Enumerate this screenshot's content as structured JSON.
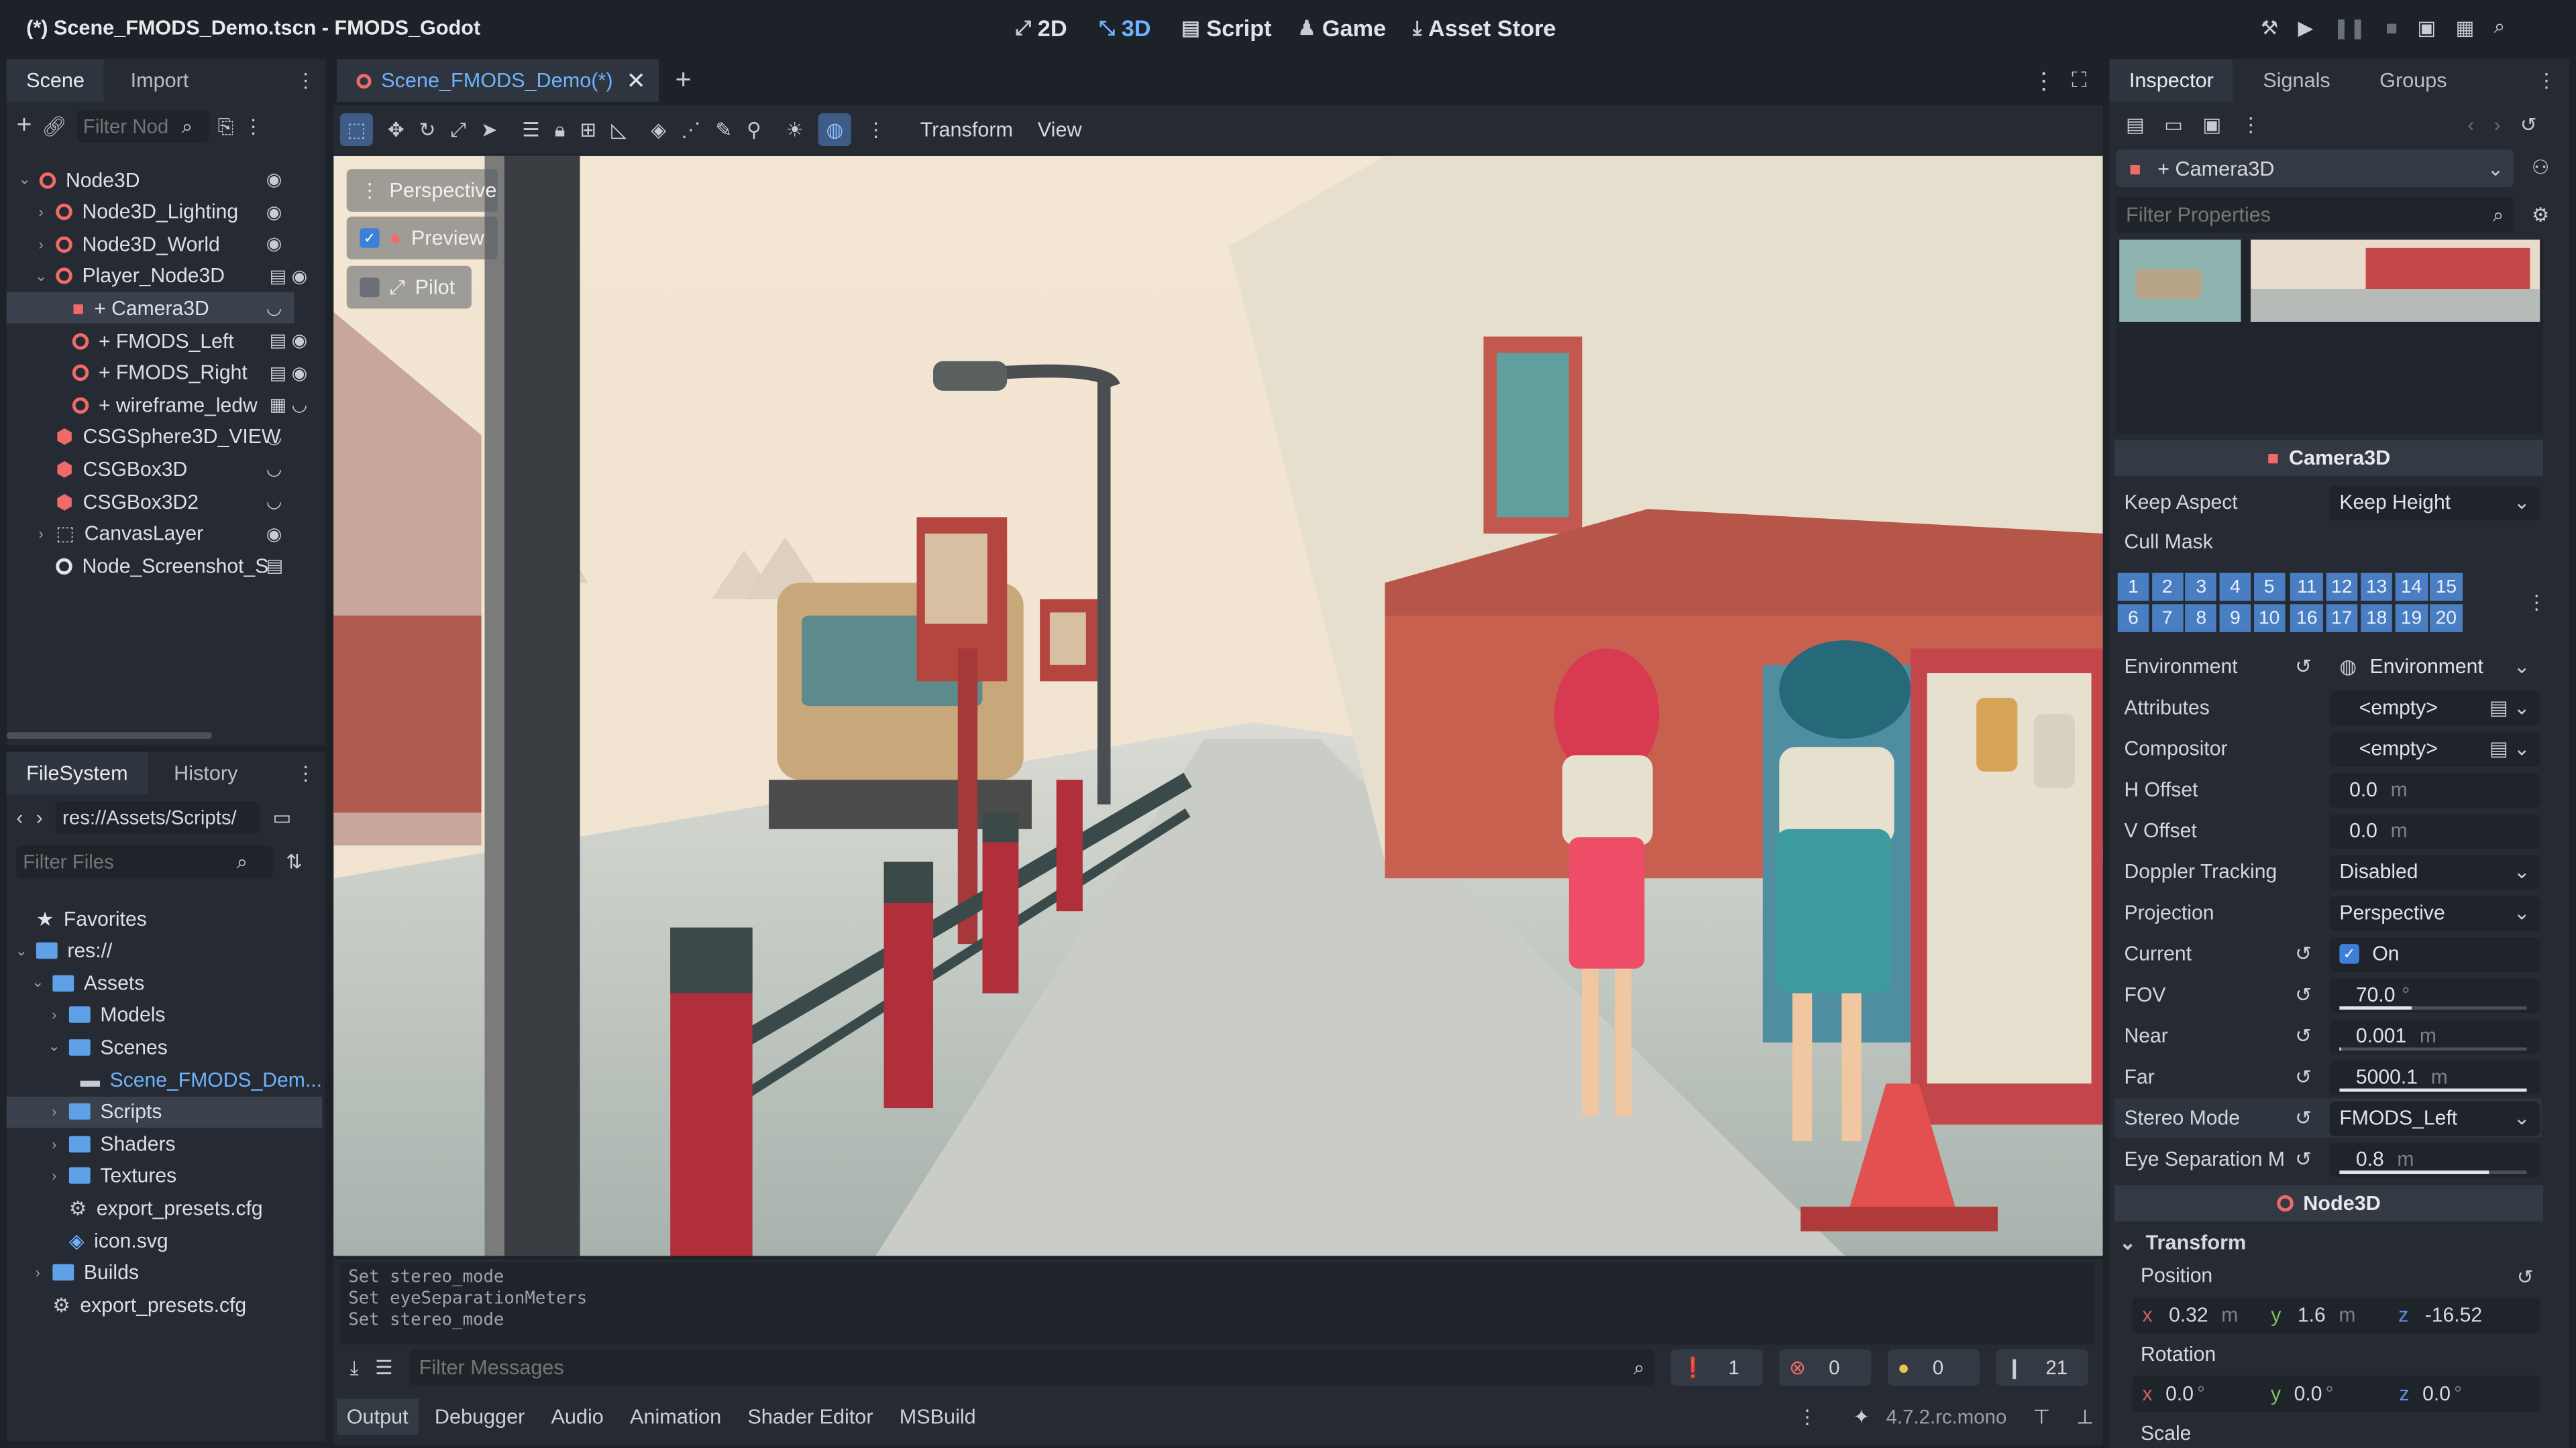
{
  "window": {
    "title": "(*) Scene_FMODS_Demo.tscn - FMODS_Godot"
  },
  "main_tabs": [
    {
      "label": "2D",
      "icon": "2d-icon"
    },
    {
      "label": "3D",
      "icon": "3d-icon"
    },
    {
      "label": "Script",
      "icon": "script-icon"
    },
    {
      "label": "Game",
      "icon": "game-icon"
    },
    {
      "label": "Asset Store",
      "icon": "asset-store-icon"
    }
  ],
  "scene_dock": {
    "tabs": [
      "Scene",
      "Import"
    ],
    "filter_placeholder": "Filter Nod",
    "nodes": [
      {
        "label": "Node3D",
        "icon": "node3d-icon",
        "depth": 0,
        "expander": "v",
        "right": "eye"
      },
      {
        "label": "Node3D_Lighting",
        "icon": "node3d-icon",
        "depth": 1,
        "expander": ">",
        "right": "eye"
      },
      {
        "label": "Node3D_World",
        "icon": "node3d-icon",
        "depth": 1,
        "expander": ">",
        "right": "eye"
      },
      {
        "label": "Player_Node3D",
        "icon": "node3d-icon",
        "depth": 1,
        "expander": "v",
        "right": "script-eye"
      },
      {
        "label": "+ Camera3D",
        "icon": "camera3d-icon",
        "depth": 2,
        "expander": "",
        "right": "hidden",
        "selected": true
      },
      {
        "label": "+ FMODS_Left",
        "icon": "node3d-icon",
        "depth": 2,
        "expander": "",
        "right": "script-eye"
      },
      {
        "label": "+ FMODS_Right",
        "icon": "node3d-icon",
        "depth": 2,
        "expander": "",
        "right": "script-eye"
      },
      {
        "label": "+ wireframe_ledw",
        "icon": "node3d-icon",
        "depth": 2,
        "expander": "",
        "right": "film-hidden"
      },
      {
        "label": "CSGSphere3D_VIEW",
        "icon": "csg-icon",
        "depth": 1,
        "expander": "",
        "right": "hidden"
      },
      {
        "label": "CSGBox3D",
        "icon": "csg-icon",
        "depth": 1,
        "expander": "",
        "right": "hidden"
      },
      {
        "label": "CSGBox3D2",
        "icon": "csg-icon",
        "depth": 1,
        "expander": "",
        "right": "hidden"
      },
      {
        "label": "CanvasLayer",
        "icon": "canvaslayer-icon",
        "depth": 1,
        "expander": ">",
        "right": "eye"
      },
      {
        "label": "Node_Screenshot_S",
        "icon": "node-icon",
        "depth": 1,
        "expander": "",
        "right": "script"
      }
    ]
  },
  "filesystem": {
    "tabs": [
      "FileSystem",
      "History"
    ],
    "path": "res://Assets/Scripts/",
    "filter_placeholder": "Filter Files",
    "items": [
      {
        "label": "Favorites",
        "icon": "star-icon",
        "depth": 0,
        "expander": ""
      },
      {
        "label": "res://",
        "icon": "folder-icon",
        "depth": 0,
        "expander": "v"
      },
      {
        "label": "Assets",
        "icon": "folder-icon",
        "depth": 1,
        "expander": "v"
      },
      {
        "label": "Models",
        "icon": "folder-icon",
        "depth": 2,
        "expander": ">"
      },
      {
        "label": "Scenes",
        "icon": "folder-icon",
        "depth": 2,
        "expander": "v"
      },
      {
        "label": "Scene_FMODS_Dem...",
        "icon": "scene-file-icon",
        "depth": 3,
        "expander": "",
        "highlight": true
      },
      {
        "label": "Scripts",
        "icon": "folder-icon",
        "depth": 2,
        "expander": ">",
        "selected": true
      },
      {
        "label": "Shaders",
        "icon": "folder-icon",
        "depth": 2,
        "expander": ">"
      },
      {
        "label": "Textures",
        "icon": "folder-icon",
        "depth": 2,
        "expander": ">"
      },
      {
        "label": "export_presets.cfg",
        "icon": "gear-file-icon",
        "depth": 2,
        "expander": ""
      },
      {
        "label": "icon.svg",
        "icon": "svg-file-icon",
        "depth": 2,
        "expander": ""
      },
      {
        "label": "Builds",
        "icon": "folder-icon",
        "depth": 1,
        "expander": ">"
      },
      {
        "label": "export_presets.cfg",
        "icon": "gear-file-icon",
        "depth": 1,
        "expander": ""
      }
    ]
  },
  "editor_tab": {
    "label": "Scene_FMODS_Demo(*)"
  },
  "viewport_menu": {
    "transform": "Transform",
    "view": "View"
  },
  "viewport_overlay": {
    "perspective": "Perspective",
    "preview": "Preview",
    "pilot": "Pilot"
  },
  "output": {
    "lines": [
      "Set stereo_mode",
      "Set eyeSeparationMeters",
      "Set stereo_mode"
    ],
    "filter_placeholder": "Filter Messages",
    "counts": {
      "info": "1",
      "errors": "0",
      "warnings": "0",
      "total": "21"
    }
  },
  "bottom_tabs": [
    "Output",
    "Debugger",
    "Audio",
    "Animation",
    "Shader Editor",
    "MSBuild"
  ],
  "version": "4.7.2.rc.mono",
  "inspector": {
    "tabs": [
      "Inspector",
      "Signals",
      "Groups"
    ],
    "object": "+ Camera3D",
    "filter_placeholder": "Filter Properties",
    "section_camera": "Camera3D",
    "section_node": "Node3D",
    "props": {
      "keep_aspect": {
        "label": "Keep Aspect",
        "value": "Keep Height"
      },
      "cull_mask": {
        "label": "Cull Mask",
        "row1": [
          "1",
          "2",
          "3",
          "4",
          "5",
          "11",
          "12",
          "13",
          "14",
          "15"
        ],
        "row2": [
          "6",
          "7",
          "8",
          "9",
          "10",
          "16",
          "17",
          "18",
          "19",
          "20"
        ]
      },
      "environment": {
        "label": "Environment",
        "value": "Environment"
      },
      "attributes": {
        "label": "Attributes",
        "value": "<empty>"
      },
      "compositor": {
        "label": "Compositor",
        "value": "<empty>"
      },
      "h_offset": {
        "label": "H Offset",
        "value": "0.0",
        "unit": "m"
      },
      "v_offset": {
        "label": "V Offset",
        "value": "0.0",
        "unit": "m"
      },
      "doppler": {
        "label": "Doppler Tracking",
        "value": "Disabled"
      },
      "projection": {
        "label": "Projection",
        "value": "Perspective"
      },
      "current": {
        "label": "Current",
        "value": "On"
      },
      "fov": {
        "label": "FOV",
        "value": "70.0",
        "unit": "°",
        "level": 0.39
      },
      "near": {
        "label": "Near",
        "value": "0.001",
        "unit": "m",
        "level": 0.0
      },
      "far": {
        "label": "Far",
        "value": "5000.1",
        "unit": "m",
        "level": 1.0
      },
      "stereo_mode": {
        "label": "Stereo Mode",
        "value": "FMODS_Left"
      },
      "eye_sep": {
        "label": "Eye Separation M",
        "value": "0.8",
        "unit": "m",
        "level": 0.8
      }
    },
    "transform": {
      "label": "Transform",
      "position_label": "Position",
      "rotation_label": "Rotation",
      "scale_label": "Scale",
      "position": {
        "x": "0.32",
        "y": "1.6",
        "z": "-16.52",
        "unit": "m"
      },
      "rotation": {
        "x": "0.0",
        "y": "0.0",
        "z": "0.0",
        "unit": "°"
      }
    }
  }
}
